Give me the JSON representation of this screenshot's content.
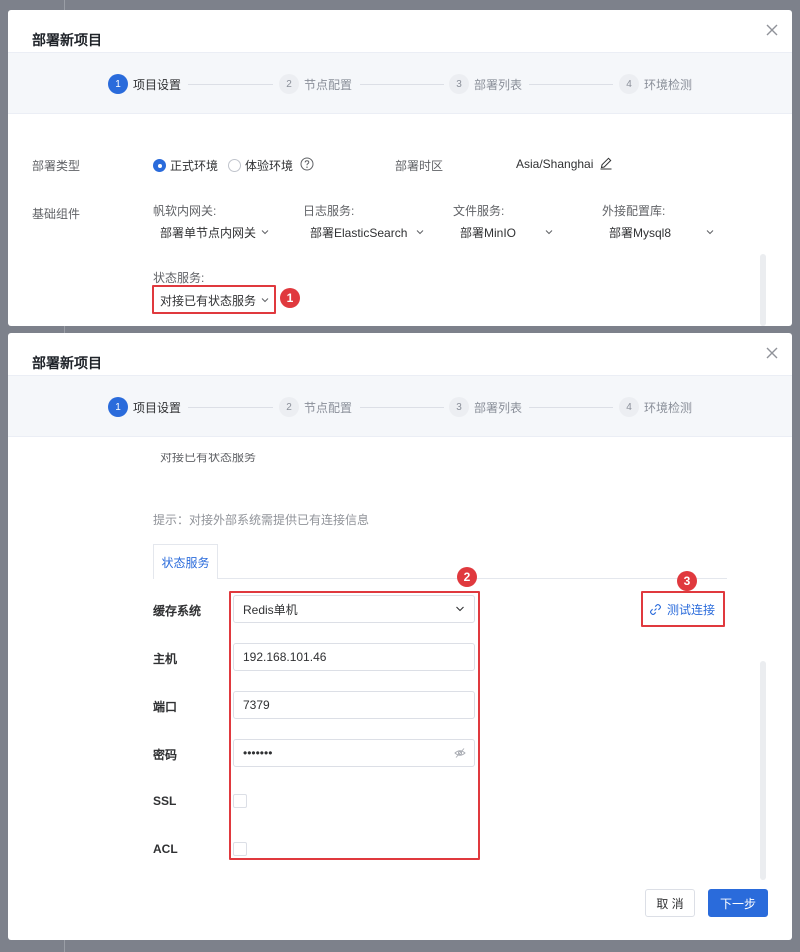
{
  "dialog_title": "部署新项目",
  "steps": [
    {
      "num": "1",
      "label": "项目设置"
    },
    {
      "num": "2",
      "label": "节点配置"
    },
    {
      "num": "3",
      "label": "部署列表"
    },
    {
      "num": "4",
      "label": "环境检测"
    }
  ],
  "deploy_type": {
    "label": "部署类型",
    "options": [
      "正式环境",
      "体验环境"
    ],
    "selected": "正式环境"
  },
  "timezone": {
    "label": "部署时区",
    "value": "Asia/Shanghai"
  },
  "components": {
    "label": "基础组件",
    "items": [
      {
        "label": "帆软内网关:",
        "value": "部署单节点内网关"
      },
      {
        "label": "日志服务:",
        "value": "部署ElasticSearch"
      },
      {
        "label": "文件服务:",
        "value": "部署MinIO"
      },
      {
        "label": "外接配置库:",
        "value": "部署Mysql8"
      }
    ],
    "state_service": {
      "label": "状态服务:",
      "value": "对接已有状态服务"
    }
  },
  "annotations": [
    "1",
    "2",
    "3"
  ],
  "hint": "提示：对接外部系统需提供已有连接信息",
  "tab": "状态服务",
  "form": {
    "cache_system": {
      "label": "缓存系统",
      "value": "Redis单机"
    },
    "host": {
      "label": "主机",
      "value": "192.168.101.46"
    },
    "port": {
      "label": "端口",
      "value": "7379"
    },
    "password": {
      "label": "密码",
      "value": "•••••••"
    },
    "ssl": {
      "label": "SSL",
      "checked": false
    },
    "acl": {
      "label": "ACL",
      "checked": false
    }
  },
  "test_connection": "测试连接",
  "buttons": {
    "cancel": "取 消",
    "next": "下一步"
  },
  "colors": {
    "primary": "#2a6bdb",
    "annotation_red": "#e0393e"
  }
}
